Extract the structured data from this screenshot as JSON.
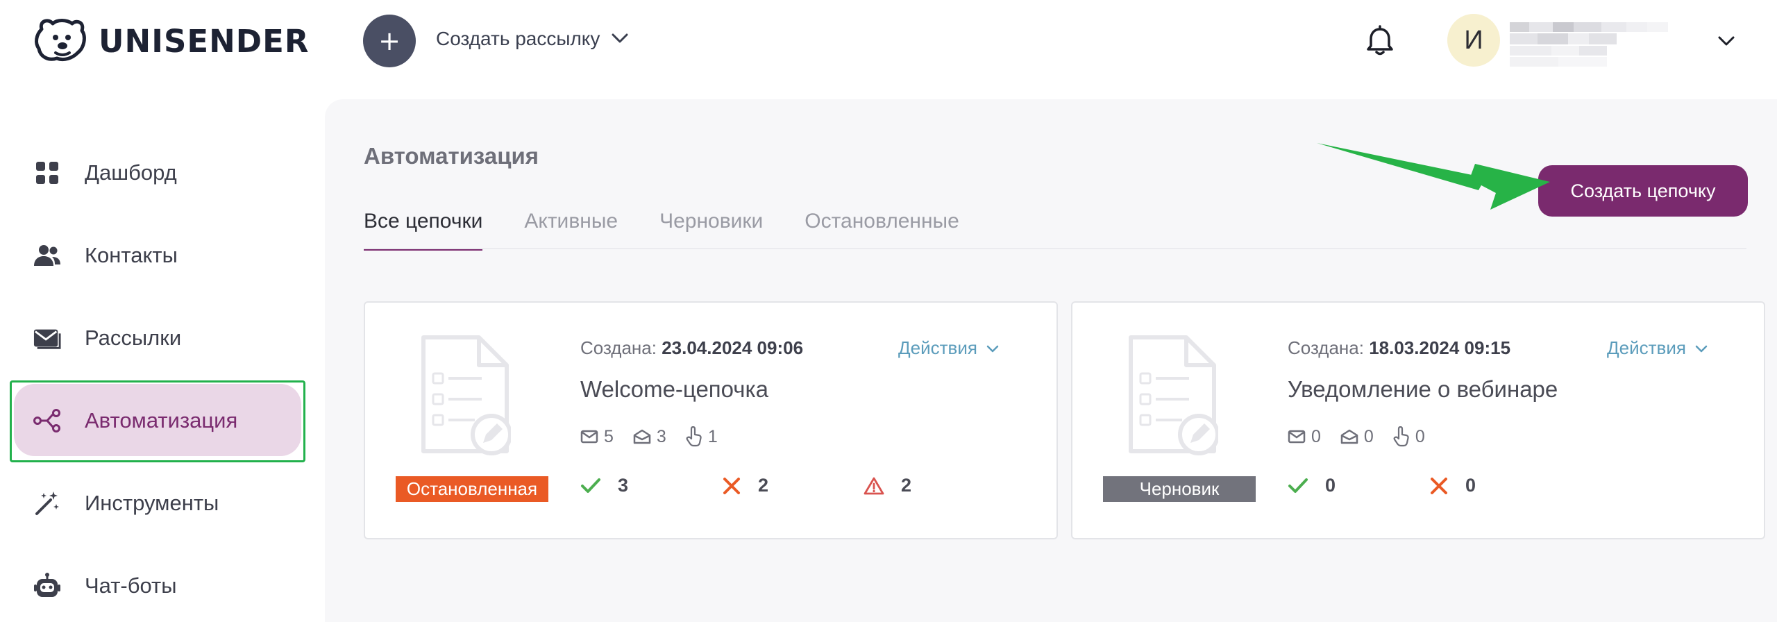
{
  "brand": {
    "name": "UNISENDER"
  },
  "header": {
    "create_mailing_label": "Создать рассылку",
    "avatar_letter": "И"
  },
  "sidebar": {
    "items": [
      {
        "label": "Дашборд",
        "icon": "dashboard-grid-icon"
      },
      {
        "label": "Контакты",
        "icon": "contacts-people-icon"
      },
      {
        "label": "Рассылки",
        "icon": "mail-icon"
      },
      {
        "label": "Автоматизация",
        "icon": "automation-nodes-icon",
        "active": true
      },
      {
        "label": "Инструменты",
        "icon": "magic-wand-icon"
      },
      {
        "label": "Чат-боты",
        "icon": "bot-icon"
      }
    ]
  },
  "main": {
    "title": "Автоматизация",
    "create_chain_label": "Создать цепочку",
    "tabs": [
      {
        "label": "Все цепочки",
        "active": true
      },
      {
        "label": "Активные"
      },
      {
        "label": "Черновики"
      },
      {
        "label": "Остановленные"
      }
    ],
    "cards": [
      {
        "created_label": "Создана:",
        "created_value": "23.04.2024 09:06",
        "actions_label": "Действия",
        "name": "Welcome-цепочка",
        "sent": "5",
        "opened": "3",
        "clicked": "1",
        "status": "Остановленная",
        "status_color": "#ea5a25",
        "ok": "3",
        "failed": "2",
        "warnings": "2"
      },
      {
        "created_label": "Создана:",
        "created_value": "18.03.2024 09:15",
        "actions_label": "Действия",
        "name": "Уведомление о вебинаре",
        "sent": "0",
        "opened": "0",
        "clicked": "0",
        "status": "Черновик",
        "status_color": "#72737c",
        "ok": "0",
        "failed": "0"
      }
    ]
  },
  "colors": {
    "accent": "#7a2a6e",
    "active_bg": "#ead7e7",
    "highlight_frame": "#22b14c",
    "annotation_arrow": "#27b347",
    "link": "#5b9cbb",
    "ok": "#4cae4f",
    "error": "#ea5a25",
    "warning": "#d9534f"
  }
}
